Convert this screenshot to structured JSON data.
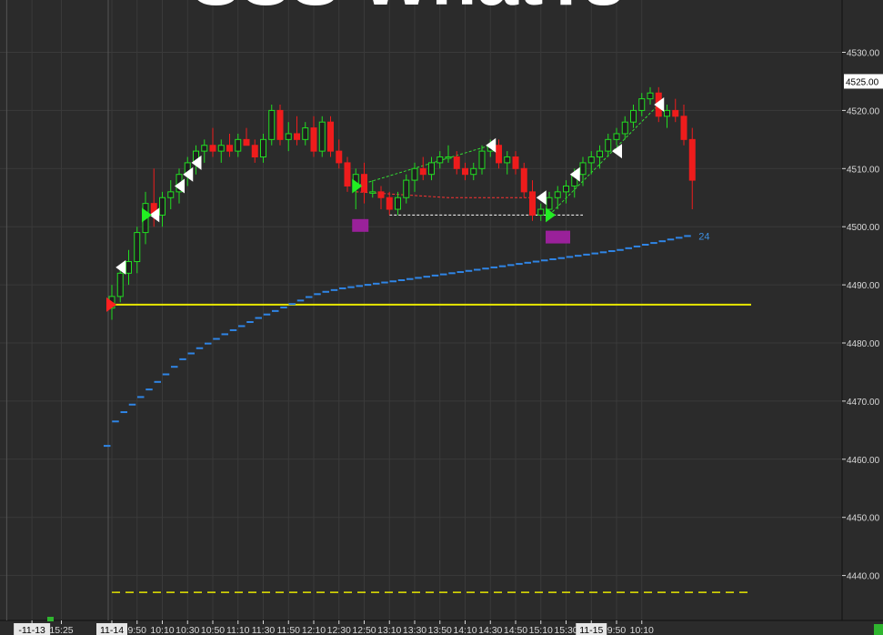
{
  "watermark": "SSS WhatTs",
  "chart_data": {
    "type": "candlestick",
    "y_ticks": [
      "4530.00",
      "4520.00",
      "4510.00",
      "4500.00",
      "4490.00",
      "4480.00",
      "4470.00",
      "4460.00",
      "4450.00",
      "4440.00"
    ],
    "y_tick_values": [
      4530,
      4520,
      4510,
      4500,
      4490,
      4480,
      4470,
      4460,
      4450,
      4440
    ],
    "ylim": [
      4433.5,
      4538.5
    ],
    "last_price_label": "4525.00",
    "last_price_value": 4525,
    "x_ticks": [
      "-11-13",
      "15:25",
      "11-14",
      "9:50",
      "10:10",
      "10:30",
      "10:50",
      "11:10",
      "11:30",
      "11:50",
      "12:10",
      "12:30",
      "12:50",
      "13:10",
      "13:30",
      "13:50",
      "14:10",
      "14:30",
      "14:50",
      "15:10",
      "15:30",
      "11-15",
      "9:50",
      "10:10"
    ],
    "x_tick_index": [
      -9.5,
      -6,
      0,
      3,
      6,
      9,
      12,
      15,
      18,
      21,
      24,
      27,
      30,
      33,
      36,
      39,
      42,
      45,
      48,
      51,
      54,
      57,
      60,
      63
    ],
    "highlighted_x_ticks": [
      "-11-13",
      "11-14",
      "11-15"
    ],
    "candles": [
      [
        4486,
        4490,
        4484,
        4488
      ],
      [
        4488,
        4493,
        4487,
        4492
      ],
      [
        4492,
        4496,
        4490,
        4494
      ],
      [
        4494,
        4500,
        4492,
        4499
      ],
      [
        4499,
        4506,
        4497,
        4504
      ],
      [
        4504,
        4510,
        4500,
        4502
      ],
      [
        4502,
        4506,
        4500,
        4505
      ],
      [
        4505,
        4508,
        4503,
        4506
      ],
      [
        4506,
        4510,
        4504,
        4509
      ],
      [
        4509,
        4512,
        4507,
        4511
      ],
      [
        4511,
        4514,
        4509,
        4513
      ],
      [
        4513,
        4515,
        4511,
        4514
      ],
      [
        4514,
        4517,
        4512,
        4513
      ],
      [
        4513,
        4515,
        4511,
        4514
      ],
      [
        4514,
        4516,
        4512,
        4513
      ],
      [
        4513,
        4516,
        4512,
        4515
      ],
      [
        4515,
        4517,
        4514,
        4514
      ],
      [
        4514,
        4515,
        4511,
        4512
      ],
      [
        4512,
        4516,
        4511,
        4515
      ],
      [
        4515,
        4521,
        4514,
        4520
      ],
      [
        4520,
        4521,
        4514,
        4515
      ],
      [
        4515,
        4518,
        4513,
        4516
      ],
      [
        4516,
        4519,
        4514,
        4515
      ],
      [
        4515,
        4518,
        4514,
        4517
      ],
      [
        4517,
        4519,
        4512,
        4513
      ],
      [
        4513,
        4519,
        4512,
        4518
      ],
      [
        4518,
        4519,
        4512,
        4513
      ],
      [
        4513,
        4515,
        4510,
        4511
      ],
      [
        4511,
        4512,
        4506,
        4507
      ],
      [
        4507,
        4510,
        4503,
        4509
      ],
      [
        4509,
        4511,
        4504,
        4506
      ],
      [
        4506,
        4508,
        4505,
        4506
      ],
      [
        4506,
        4507,
        4503,
        4505
      ],
      [
        4505,
        4506,
        4502,
        4503
      ],
      [
        4503,
        4506,
        4502,
        4505
      ],
      [
        4505,
        4509,
        4504,
        4508
      ],
      [
        4508,
        4511,
        4506,
        4510
      ],
      [
        4510,
        4512,
        4508,
        4509
      ],
      [
        4509,
        4512,
        4508,
        4511
      ],
      [
        4511,
        4513,
        4510,
        4512
      ],
      [
        4512,
        4514,
        4511,
        4512
      ],
      [
        4512,
        4513,
        4509,
        4510
      ],
      [
        4510,
        4511,
        4508,
        4509
      ],
      [
        4509,
        4511,
        4508,
        4510
      ],
      [
        4510,
        4514,
        4509,
        4513
      ],
      [
        4513,
        4515,
        4512,
        4514
      ],
      [
        4514,
        4515,
        4510,
        4511
      ],
      [
        4511,
        4513,
        4509,
        4512
      ],
      [
        4512,
        4513,
        4509,
        4510
      ],
      [
        4510,
        4511,
        4505,
        4506
      ],
      [
        4506,
        4508,
        4501,
        4502
      ],
      [
        4502,
        4504,
        4501,
        4503
      ],
      [
        4503,
        4506,
        4502,
        4505
      ],
      [
        4505,
        4507,
        4503,
        4506
      ],
      [
        4506,
        4508,
        4504,
        4507
      ],
      [
        4507,
        4510,
        4505,
        4509
      ],
      [
        4509,
        4512,
        4507,
        4511
      ],
      [
        4511,
        4513,
        4509,
        4512
      ],
      [
        4512,
        4514,
        4510,
        4513
      ],
      [
        4513,
        4516,
        4512,
        4515
      ],
      [
        4515,
        4517,
        4514,
        4516
      ],
      [
        4516,
        4519,
        4515,
        4518
      ],
      [
        4518,
        4521,
        4517,
        4520
      ],
      [
        4520,
        4523,
        4519,
        4522
      ],
      [
        4522,
        4524,
        4521,
        4523
      ],
      [
        4523,
        4524,
        4518,
        4519
      ],
      [
        4519,
        4521,
        4517,
        4520
      ],
      [
        4520,
        4522,
        4518,
        4519
      ],
      [
        4519,
        4521,
        4514,
        4515
      ],
      [
        4515,
        4517,
        4503,
        4508
      ]
    ],
    "vwap_series_name": "24",
    "vwap": [
      4462.3,
      4466.5,
      4468.1,
      4469.4,
      4470.7,
      4472.0,
      4473.3,
      4474.6,
      4475.9,
      4477.2,
      4478.2,
      4479.1,
      4479.9,
      4480.7,
      4481.5,
      4482.2,
      4482.9,
      4483.6,
      4484.3,
      4484.9,
      4485.5,
      4486.1,
      4486.7,
      4487.3,
      4487.9,
      4488.4,
      4488.8,
      4489.1,
      4489.4,
      4489.6,
      4489.8,
      4490.0,
      4490.2,
      4490.4,
      4490.6,
      4490.8,
      4491.0,
      4491.2,
      4491.4,
      4491.6,
      4491.8,
      4492.0,
      4492.2,
      4492.4,
      4492.6,
      4492.8,
      4493.0,
      4493.2,
      4493.4,
      4493.6,
      4493.8,
      4494.0,
      4494.2,
      4494.4,
      4494.6,
      4494.8,
      4495.0,
      4495.2,
      4495.4,
      4495.6,
      4495.8,
      4496.0,
      4496.3,
      4496.6,
      4496.9,
      4497.2,
      4497.5,
      4497.8,
      4498.1,
      4498.4
    ],
    "hline_solid": 4486.6,
    "hline_dashed": 4437.1,
    "white_markers": [
      [
        1,
        4493
      ],
      [
        5,
        4502
      ],
      [
        8,
        4507
      ],
      [
        9,
        4509
      ],
      [
        10,
        4511
      ],
      [
        45,
        4514
      ],
      [
        51,
        4505
      ],
      [
        55,
        4509
      ],
      [
        60,
        4513
      ],
      [
        65,
        4521
      ]
    ],
    "green_markers": [
      [
        4,
        4502
      ],
      [
        29,
        4507
      ],
      [
        52,
        4502
      ]
    ],
    "red_marker": [
      0,
      4486.6
    ],
    "purple_boxes": [
      [
        29,
        4501
      ],
      [
        52,
        4499
      ]
    ],
    "green_trend": [
      [
        29,
        4507
      ],
      [
        45,
        4514
      ]
    ],
    "red_trend": [
      [
        29,
        4506
      ],
      [
        40,
        4505
      ],
      [
        51,
        4505
      ]
    ],
    "white_support": [
      [
        33,
        4502
      ],
      [
        56,
        4502
      ]
    ],
    "green_trend2": [
      [
        52,
        4502
      ],
      [
        65,
        4521
      ]
    ]
  }
}
